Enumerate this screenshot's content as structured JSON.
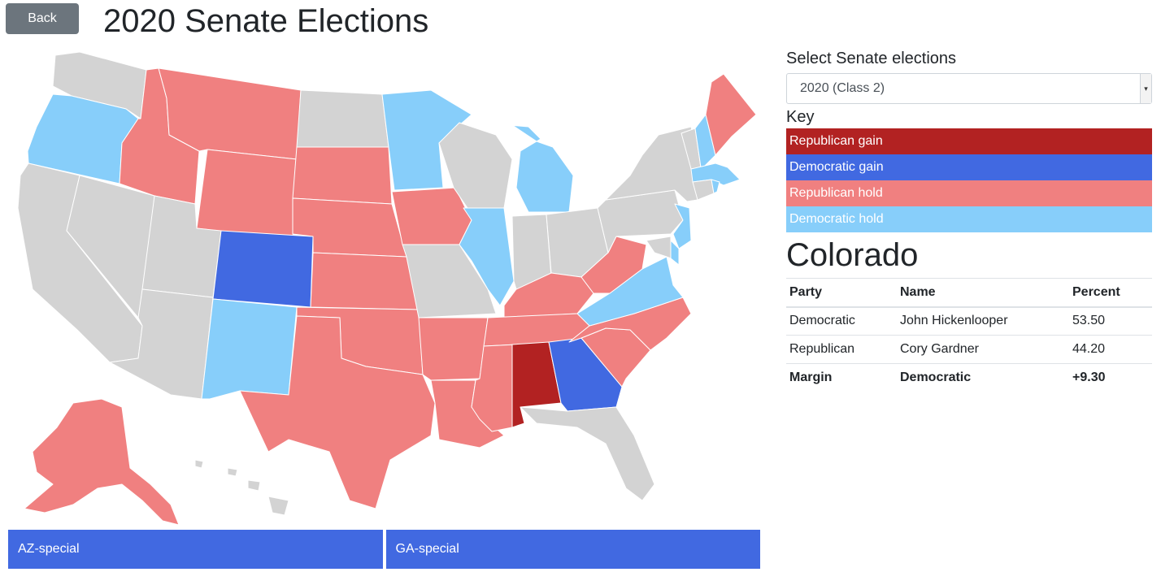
{
  "header": {
    "back_label": "Back",
    "title": "2020 Senate Elections"
  },
  "colors": {
    "republican_gain": "#b22222",
    "democratic_gain": "#4169e1",
    "republican_hold": "#f08080",
    "democratic_hold": "#87cefa",
    "no_election": "#d3d3d3"
  },
  "map": {
    "states": [
      {
        "id": "WA",
        "status": "no_election"
      },
      {
        "id": "OR",
        "status": "democratic_hold"
      },
      {
        "id": "CA",
        "status": "no_election"
      },
      {
        "id": "ID",
        "status": "republican_hold"
      },
      {
        "id": "NV",
        "status": "no_election"
      },
      {
        "id": "MT",
        "status": "republican_hold"
      },
      {
        "id": "WY",
        "status": "republican_hold"
      },
      {
        "id": "UT",
        "status": "no_election"
      },
      {
        "id": "AZ",
        "status": "no_election"
      },
      {
        "id": "CO",
        "status": "democratic_gain"
      },
      {
        "id": "NM",
        "status": "democratic_hold"
      },
      {
        "id": "ND",
        "status": "no_election"
      },
      {
        "id": "SD",
        "status": "republican_hold"
      },
      {
        "id": "NE",
        "status": "republican_hold"
      },
      {
        "id": "KS",
        "status": "republican_hold"
      },
      {
        "id": "OK",
        "status": "republican_hold"
      },
      {
        "id": "TX",
        "status": "republican_hold"
      },
      {
        "id": "MN",
        "status": "democratic_hold"
      },
      {
        "id": "IA",
        "status": "republican_hold"
      },
      {
        "id": "MO",
        "status": "no_election"
      },
      {
        "id": "AR",
        "status": "republican_hold"
      },
      {
        "id": "LA",
        "status": "republican_hold"
      },
      {
        "id": "WI",
        "status": "no_election"
      },
      {
        "id": "IL",
        "status": "democratic_hold"
      },
      {
        "id": "MI",
        "status": "democratic_hold"
      },
      {
        "id": "IN",
        "status": "no_election"
      },
      {
        "id": "OH",
        "status": "no_election"
      },
      {
        "id": "KY",
        "status": "republican_hold"
      },
      {
        "id": "TN",
        "status": "republican_hold"
      },
      {
        "id": "MS",
        "status": "republican_hold"
      },
      {
        "id": "AL",
        "status": "republican_gain"
      },
      {
        "id": "GA",
        "status": "democratic_gain"
      },
      {
        "id": "FL",
        "status": "no_election"
      },
      {
        "id": "SC",
        "status": "republican_hold"
      },
      {
        "id": "NC",
        "status": "republican_hold"
      },
      {
        "id": "VA",
        "status": "democratic_hold"
      },
      {
        "id": "WV",
        "status": "republican_hold"
      },
      {
        "id": "PA",
        "status": "no_election"
      },
      {
        "id": "NY",
        "status": "no_election"
      },
      {
        "id": "VT",
        "status": "no_election"
      },
      {
        "id": "NH",
        "status": "democratic_hold"
      },
      {
        "id": "ME",
        "status": "republican_hold"
      },
      {
        "id": "MA",
        "status": "democratic_hold"
      },
      {
        "id": "RI",
        "status": "democratic_hold"
      },
      {
        "id": "CT",
        "status": "no_election"
      },
      {
        "id": "NJ",
        "status": "democratic_hold"
      },
      {
        "id": "DE",
        "status": "democratic_hold"
      },
      {
        "id": "MD",
        "status": "no_election"
      },
      {
        "id": "AK",
        "status": "republican_hold"
      },
      {
        "id": "HI",
        "status": "no_election"
      }
    ]
  },
  "specials": [
    {
      "label": "AZ-special"
    },
    {
      "label": "GA-special"
    }
  ],
  "sidebar": {
    "select_label": "Select Senate elections",
    "select_value": "2020 (Class 2)",
    "key_label": "Key",
    "key_items": [
      {
        "label": "Republican gain",
        "color": "#b22222"
      },
      {
        "label": "Democratic gain",
        "color": "#4169e1"
      },
      {
        "label": "Republican hold",
        "color": "#f08080"
      },
      {
        "label": "Democratic hold",
        "color": "#87cefa"
      }
    ],
    "state_name": "Colorado",
    "table": {
      "headers": [
        "Party",
        "Name",
        "Percent"
      ],
      "rows": [
        [
          "Democratic",
          "John Hickenlooper",
          "53.50"
        ],
        [
          "Republican",
          "Cory Gardner",
          "44.20"
        ]
      ],
      "margin_row": [
        "Margin",
        "Democratic",
        "+9.30"
      ]
    }
  }
}
